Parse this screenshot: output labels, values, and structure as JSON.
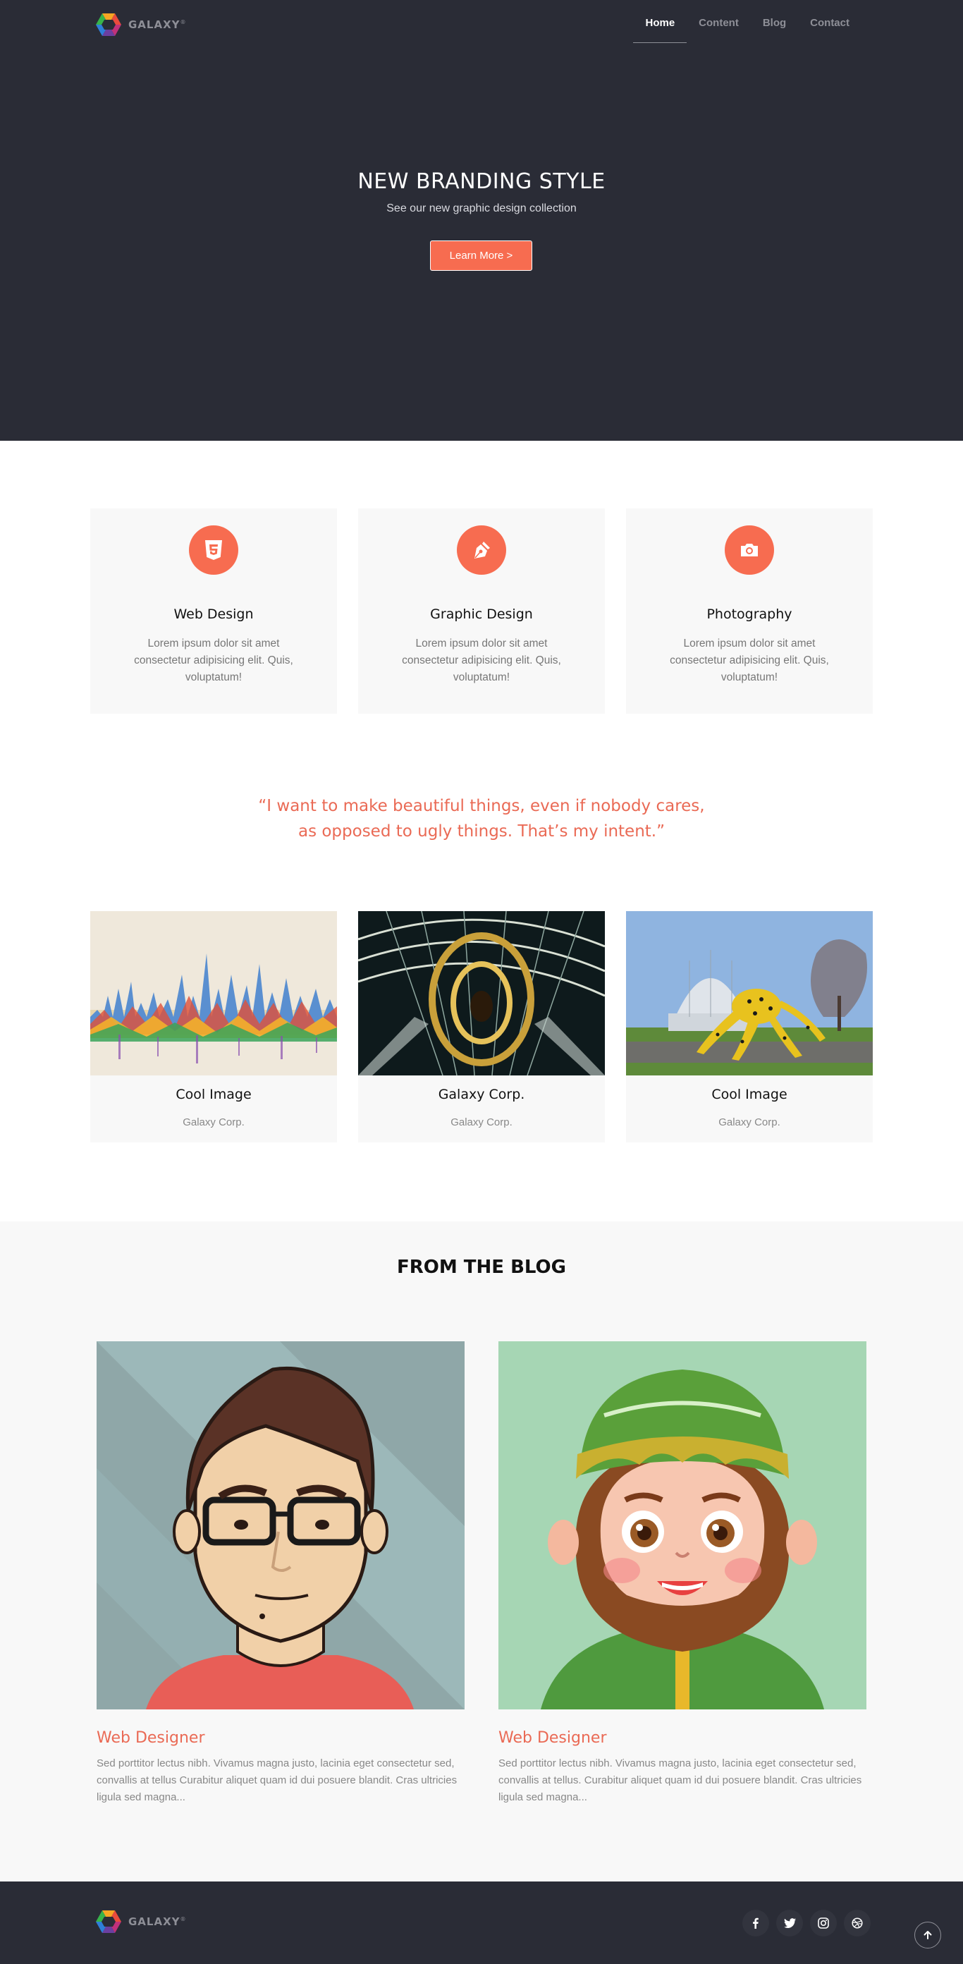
{
  "brand": {
    "name": "GALAXY",
    "mark": "®"
  },
  "nav": {
    "items": [
      "Home",
      "Content",
      "Blog",
      "Contact"
    ],
    "active": "Home"
  },
  "hero": {
    "title": "NEW BRANDING STYLE",
    "subtitle": "See our new graphic design collection",
    "button": "Learn More >"
  },
  "services": [
    {
      "icon": "html5-icon",
      "title": "Web Design",
      "text": "Lorem ipsum dolor sit amet consectetur adipisicing elit. Quis, voluptatum!"
    },
    {
      "icon": "pen-nib-icon",
      "title": "Graphic Design",
      "text": "Lorem ipsum dolor sit amet consectetur adipisicing elit. Quis, voluptatum!"
    },
    {
      "icon": "camera-icon",
      "title": "Photography",
      "text": "Lorem ipsum dolor sit amet consectetur adipisicing elit. Quis, voluptatum!"
    }
  ],
  "quote": {
    "line1": "“I want to make beautiful things, even if nobody cares,",
    "line2": "as opposed to ugly things. That’s my intent.”"
  },
  "gallery": [
    {
      "title": "Cool Image",
      "subtitle": "Galaxy Corp."
    },
    {
      "title": "Galaxy Corp.",
      "subtitle": "Galaxy Corp."
    },
    {
      "title": "Cool Image",
      "subtitle": "Galaxy Corp."
    }
  ],
  "blog": {
    "title": "FROM THE BLOG",
    "posts": [
      {
        "title": "Web Designer",
        "text": "Sed porttitor lectus nibh. Vivamus magna justo, lacinia eget consectetur sed, convallis at tellus Curabitur aliquet quam id dui posuere blandit. Cras ultricies ligula sed magna..."
      },
      {
        "title": "Web Designer",
        "text": "Sed porttitor lectus nibh. Vivamus magna justo, lacinia eget consectetur sed, convallis at tellus. Curabitur aliquet quam id dui posuere blandit. Cras ultricies ligula sed magna..."
      }
    ]
  },
  "footer": {
    "socials": [
      "facebook-icon",
      "twitter-icon",
      "instagram-icon",
      "dribbble-icon"
    ],
    "to_top_icon": "arrow-up-icon"
  },
  "colors": {
    "accent": "#f76c50",
    "dark": "#2a2c36",
    "light": "#f8f8f8",
    "quote": "#ea6a55"
  }
}
